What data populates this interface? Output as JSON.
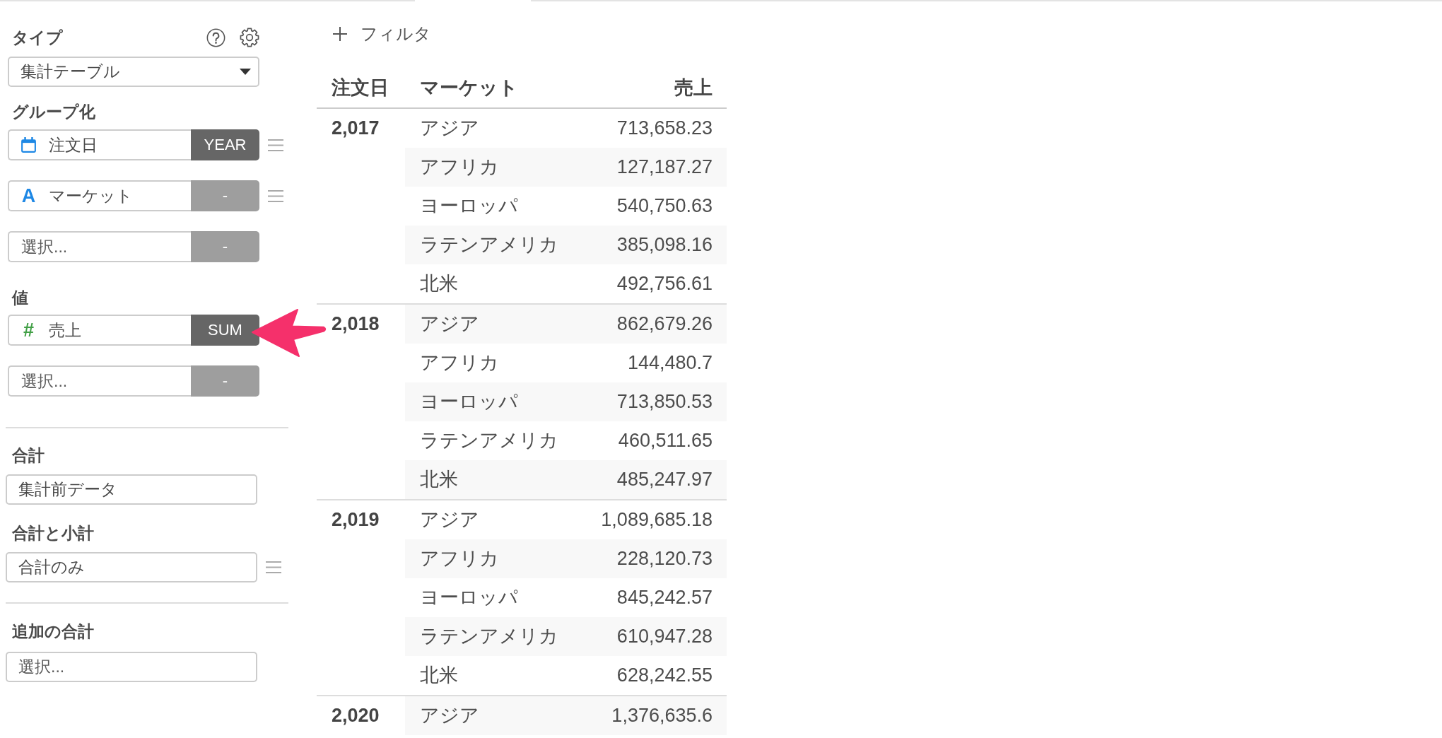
{
  "settings_panel": {
    "type_section": {
      "label": "タイプ",
      "select": {
        "value": "集計テーブル",
        "dropdown_caret": true
      }
    },
    "grouping_section": {
      "label": "グループ化",
      "fields": [
        {
          "kind": "date",
          "value": "注文日",
          "aggregation": "YEAR",
          "disabled": false,
          "drag_handle": true
        },
        {
          "kind": "text",
          "type_glyph": "A",
          "value": "マーケット",
          "aggregation": "-",
          "disabled": true,
          "drag_handle": true
        },
        {
          "placeholder": "選択...",
          "aggregation": "-",
          "disabled": true
        }
      ]
    },
    "values_section": {
      "label": "値",
      "fields": [
        {
          "kind": "number",
          "type_glyph": "#",
          "value": "売上",
          "aggregation": "SUM",
          "disabled": false
        },
        {
          "placeholder": "選択...",
          "aggregation": "-",
          "disabled": true
        }
      ]
    },
    "total_section": {
      "label": "合計",
      "select": {
        "value": "集計前データ"
      }
    },
    "subtotal_section": {
      "label": "合計と小計",
      "select": {
        "value": "合計のみ",
        "drag_handle": true
      }
    },
    "extra_total_section": {
      "label": "追加の合計",
      "select": {
        "placeholder": "選択..."
      }
    }
  },
  "main": {
    "filter_button": {
      "label": "フィルタ"
    },
    "table": {
      "columns": [
        "注文日",
        "マーケット",
        "売上"
      ],
      "groups": [
        {
          "order_date": "2,017",
          "rows": [
            {
              "market": "アジア",
              "sales": "713,658.23"
            },
            {
              "market": "アフリカ",
              "sales": "127,187.27"
            },
            {
              "market": "ヨーロッパ",
              "sales": "540,750.63"
            },
            {
              "market": "ラテンアメリカ",
              "sales": "385,098.16"
            },
            {
              "market": "北米",
              "sales": "492,756.61"
            }
          ]
        },
        {
          "order_date": "2,018",
          "rows": [
            {
              "market": "アジア",
              "sales": "862,679.26"
            },
            {
              "market": "アフリカ",
              "sales": "144,480.7"
            },
            {
              "market": "ヨーロッパ",
              "sales": "713,850.53"
            },
            {
              "market": "ラテンアメリカ",
              "sales": "460,511.65"
            },
            {
              "market": "北米",
              "sales": "485,247.97"
            }
          ]
        },
        {
          "order_date": "2,019",
          "rows": [
            {
              "market": "アジア",
              "sales": "1,089,685.18"
            },
            {
              "market": "アフリカ",
              "sales": "228,120.73"
            },
            {
              "market": "ヨーロッパ",
              "sales": "845,242.57"
            },
            {
              "market": "ラテンアメリカ",
              "sales": "610,947.28"
            },
            {
              "market": "北米",
              "sales": "628,242.55"
            }
          ]
        },
        {
          "order_date": "2,020",
          "rows": [
            {
              "market": "アジア",
              "sales": "1,376,635.6"
            }
          ]
        }
      ]
    }
  },
  "annotations": [
    {
      "kind": "arrow"
    }
  ]
}
